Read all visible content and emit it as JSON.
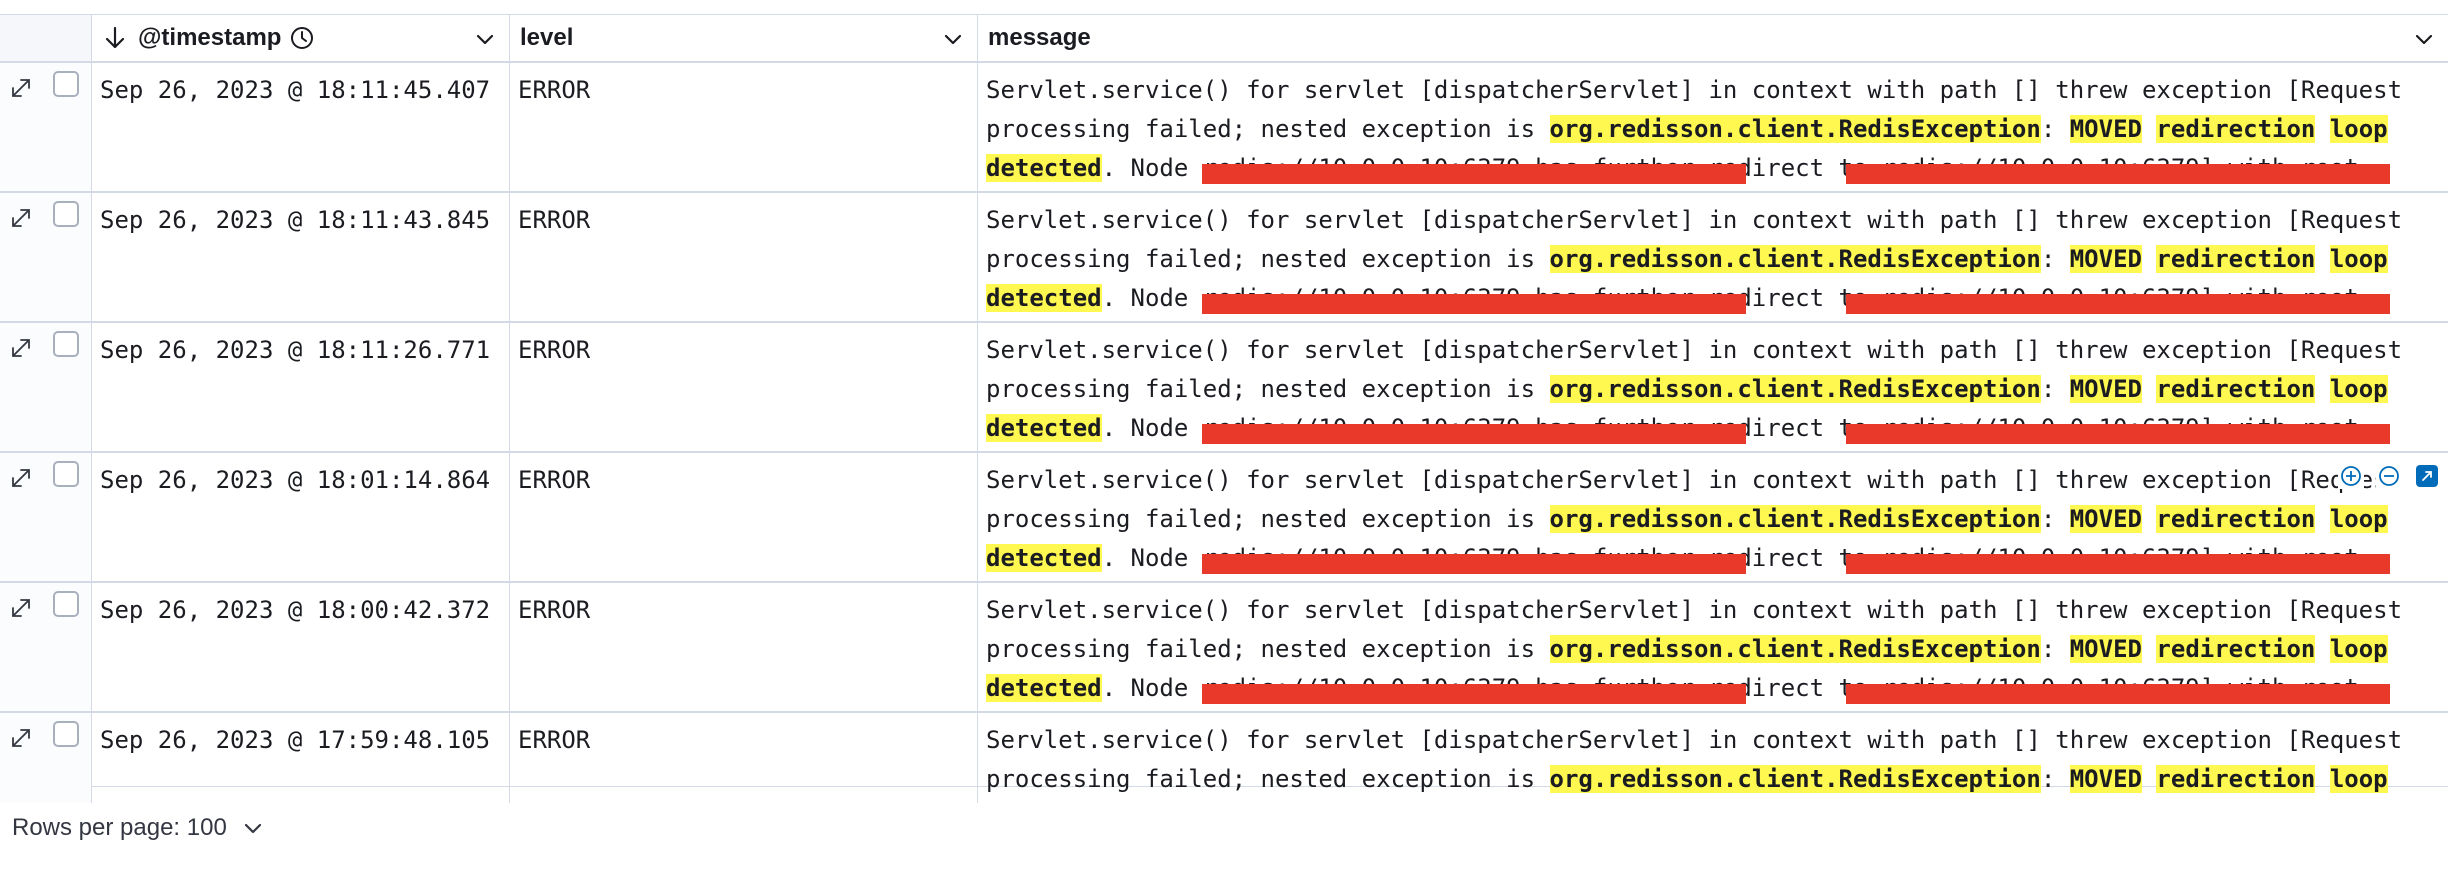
{
  "columns": {
    "timestamp": "@timestamp",
    "level": "level",
    "message": "message"
  },
  "icons": {
    "sort": "arrow-down-icon",
    "clock": "clock-icon",
    "chevron": "chevron-down-icon",
    "expand": "expand-icon",
    "filter_in": "magnify-plus-icon",
    "filter_out": "magnify-minus-icon",
    "popover": "popout-icon"
  },
  "colors": {
    "highlight": "#fff850",
    "redaction": "#e8392b",
    "popover_button": "#006bb8",
    "border": "#d3dae6"
  },
  "message_tokens": {
    "l1": "Servlet.service() for servlet [dispatcherServlet] in context with path [] threw exception [Request",
    "l2_a": "processing failed; nested exception is ",
    "l2_b": "org.redisson.client.RedisException",
    "l2_c": ": ",
    "l2_d": "MOVED",
    "l2_e": " ",
    "l2_f": "redirection",
    "l2_g": " ",
    "l2_h": "loop",
    "l3_a": "detected",
    "l3_b": ". Node redis://10.0.0.10:6379 has further redirect to redis://10.0.0.10:6379] with root …"
  },
  "rows": [
    {
      "timestamp": "Sep 26, 2023 @ 18:11:45.407",
      "level": "ERROR"
    },
    {
      "timestamp": "Sep 26, 2023 @ 18:11:43.845",
      "level": "ERROR"
    },
    {
      "timestamp": "Sep 26, 2023 @ 18:11:26.771",
      "level": "ERROR"
    },
    {
      "timestamp": "Sep 26, 2023 @ 18:01:14.864",
      "level": "ERROR"
    },
    {
      "timestamp": "Sep 26, 2023 @ 18:00:42.372",
      "level": "ERROR"
    },
    {
      "timestamp": "Sep 26, 2023 @ 17:59:48.105",
      "level": "ERROR"
    }
  ],
  "footer": {
    "rows_per_page": "Rows per page: 100"
  }
}
